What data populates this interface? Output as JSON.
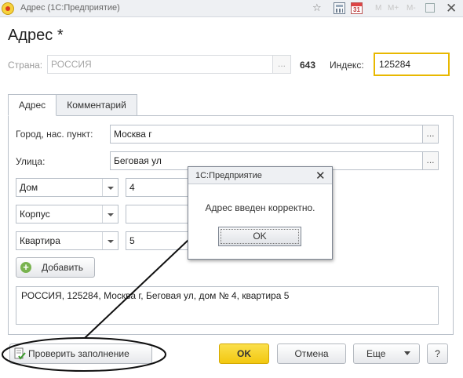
{
  "window": {
    "title": "Адрес   (1С:Предприятие)",
    "toolbar_mem": [
      "M",
      "M+",
      "M-"
    ]
  },
  "form": {
    "title": "Адрес *"
  },
  "country": {
    "label": "Страна:",
    "value": "РОССИЯ",
    "code": "643"
  },
  "index": {
    "label": "Индекс:",
    "value": "125284"
  },
  "tabs": [
    {
      "label": "Адрес"
    },
    {
      "label": "Комментарий"
    }
  ],
  "address": {
    "city": {
      "label": "Город, нас. пункт:",
      "value": "Москва г"
    },
    "street": {
      "label": "Улица:",
      "value": "Беговая ул"
    },
    "rows": [
      {
        "type": "Дом",
        "value": "4"
      },
      {
        "type": "Корпус",
        "value": ""
      },
      {
        "type": "Квартира",
        "value": "5"
      }
    ],
    "add_button": "Добавить",
    "summary": "РОССИЯ, 125284, Москва г, Беговая ул, дом № 4, квартира 5"
  },
  "dialog": {
    "title": "1С:Предприятие",
    "message": "Адрес введен корректно.",
    "ok": "OK"
  },
  "footer": {
    "check_button": "Проверить заполнение",
    "ok": "OK",
    "cancel": "Отмена",
    "more": "Еще",
    "help": "?"
  }
}
